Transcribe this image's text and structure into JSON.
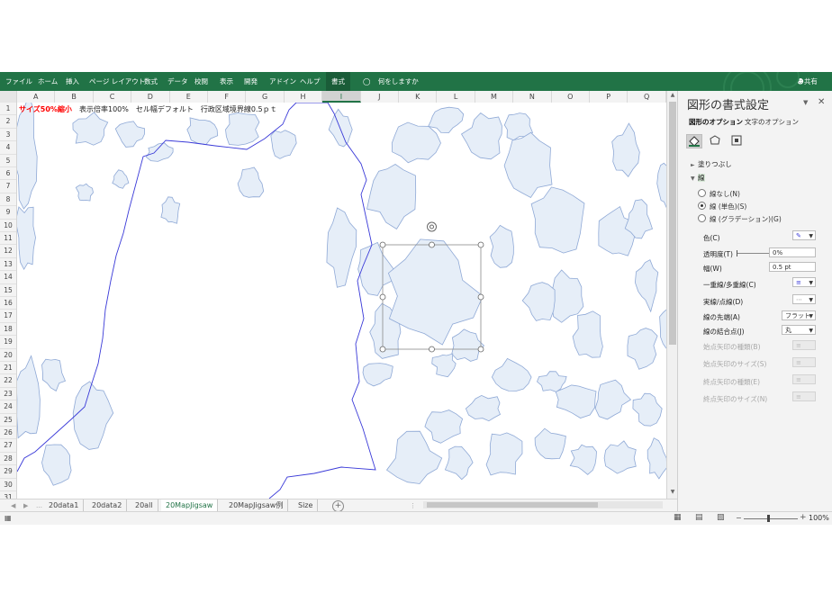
{
  "ribbon": {
    "tabs": [
      "ファイル",
      "ホーム",
      "挿入",
      "ページ レイアウト",
      "数式",
      "データ",
      "校閲",
      "表示",
      "開発",
      "アドイン",
      "ヘルプ",
      "書式"
    ],
    "active_tab": "書式",
    "tell_me": "何をしますか",
    "share": "共有"
  },
  "columns": [
    "A",
    "B",
    "C",
    "D",
    "E",
    "F",
    "G",
    "H",
    "I",
    "J",
    "K",
    "L",
    "M",
    "N",
    "O",
    "P",
    "Q"
  ],
  "rows": [
    "1",
    "2",
    "3",
    "4",
    "5",
    "6",
    "7",
    "8",
    "9",
    "10",
    "11",
    "12",
    "13",
    "14",
    "15",
    "16",
    "17",
    "18",
    "19",
    "20",
    "21",
    "22",
    "23",
    "24",
    "25",
    "26",
    "27",
    "28",
    "29",
    "30",
    "31"
  ],
  "row1": {
    "a1": "サイズ50%縮小",
    "note": "表示倍率100%　セル幅デフォルト　行政区域境界線0.5ｐｔ"
  },
  "sheets": [
    "20data1",
    "20data2",
    "20all",
    "20MapJigsaw",
    "20MapJigsaw例",
    "Size"
  ],
  "active_sheet": "20MapJigsaw",
  "status": {
    "zoom": "100%"
  },
  "pane": {
    "title": "図形の書式設定",
    "tabs": [
      "図形のオプション",
      "文字のオプション"
    ],
    "sections": {
      "fill": "塗りつぶし",
      "line": "線"
    },
    "radios": [
      "線なし(N)",
      "線 (単色)(S)",
      "線 (グラデーション)(G)"
    ],
    "selected_radio": 1,
    "props": {
      "color": "色(C)",
      "transparency": "透明度(T)",
      "width": "幅(W)",
      "compound": "一重線/多重線(C)",
      "dash": "実線/点線(D)",
      "cap": "線の先端(A)",
      "join": "線の結合点(J)",
      "begin_arrow_type": "始点矢印の種類(B)",
      "begin_arrow_size": "始点矢印のサイズ(S)",
      "end_arrow_type": "終点矢印の種類(E)",
      "end_arrow_size": "終点矢印のサイズ(N)"
    },
    "values": {
      "transparency": "0%",
      "width": "0.5 pt",
      "cap": "フラット",
      "join": "丸"
    }
  },
  "colors": {
    "ribbon": "#217346",
    "region_fill": "#e6eef8",
    "region_stroke": "#8fa9d6",
    "boundary": "#3a3ad8"
  }
}
